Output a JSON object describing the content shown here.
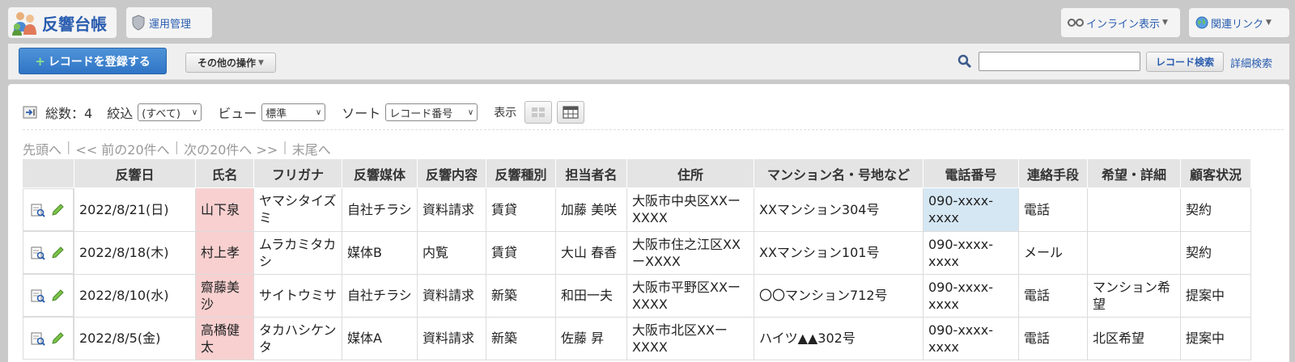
{
  "header": {
    "app_title": "反響台帳",
    "admin_label": "運用管理",
    "inline_label": "インライン表示",
    "related_label": "関連リンク"
  },
  "toolbar": {
    "register_label": "レコードを登録する",
    "other_label": "その他の操作",
    "search_value": "",
    "search_button": "レコード検索",
    "advanced_search": "詳細検索"
  },
  "controls": {
    "total_label": "総数：4",
    "filter_label": "絞込",
    "filter_value": "(すべて)",
    "view_label": "ビュー",
    "view_value": "標準",
    "sort_label": "ソート",
    "sort_value": "レコード番号",
    "display_label": "表示"
  },
  "pager": {
    "first": "先頭へ",
    "prev": "<< 前の20件へ",
    "next": "次の20件へ >>",
    "last": "末尾へ"
  },
  "table": {
    "columns": [
      "",
      "反響日",
      "氏名",
      "フリガナ",
      "反響媒体",
      "反響内容",
      "反響種別",
      "担当者名",
      "住所",
      "マンション名・号地など",
      "電話番号",
      "連絡手段",
      "希望・詳細",
      "顧客状況"
    ],
    "rows": [
      [
        "2022/8/21(日)",
        "山下泉",
        "ヤマシタイズミ",
        "自社チラシ",
        "資料請求",
        "賃貸",
        "加藤 美咲",
        "大阪市中央区XXーXXXX",
        "XXマンション304号",
        "090-xxxx-xxxx",
        "電話",
        "",
        "契約"
      ],
      [
        "2022/8/18(木)",
        "村上孝",
        "ムラカミタカシ",
        "媒体B",
        "内覧",
        "賃貸",
        "大山 春香",
        "大阪市住之江区XXーXXXX",
        "XXマンション101号",
        "090-xxxx-xxxx",
        "メール",
        "",
        "契約"
      ],
      [
        "2022/8/10(水)",
        "齋藤美沙",
        "サイトウミサ",
        "自社チラシ",
        "資料請求",
        "新築",
        "和田一夫",
        "大阪市平野区XXーXXXX",
        "〇〇マンション712号",
        "090-xxxx-xxxx",
        "電話",
        "マンション希望",
        "提案中"
      ],
      [
        "2022/8/5(金)",
        "高橋健太",
        "タカハシケンタ",
        "媒体A",
        "資料請求",
        "新築",
        "佐藤 昇",
        "大阪市北区XXーXXXX",
        "ハイツ▲▲302号",
        "090-xxxx-xxxx",
        "電話",
        "北区希望",
        "提案中"
      ]
    ]
  },
  "colors": {
    "accent": "#2a5db0",
    "name_highlight": "#f8d0d0",
    "cell_highlight": "#d5e7f3"
  }
}
